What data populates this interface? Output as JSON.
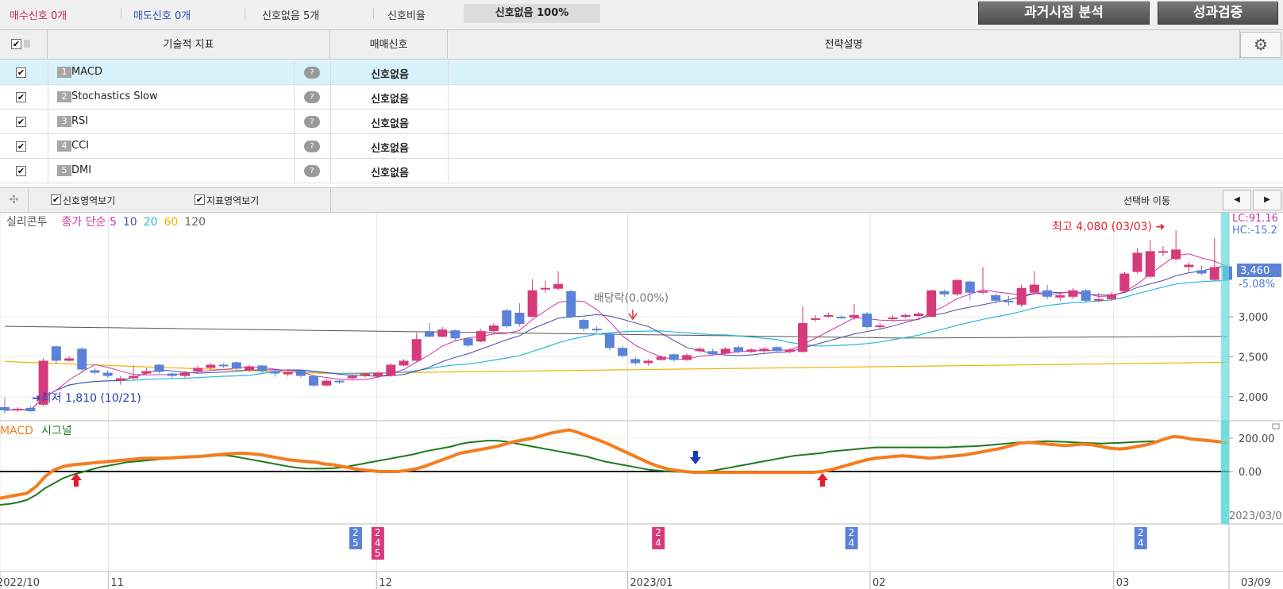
{
  "summary": {
    "buy": "매수신호 0개",
    "sell": "매도신호 0개",
    "none": "신호없음 5개",
    "ratio_label": "신호비율",
    "ratio_value": "신호없음 100%"
  },
  "buttons": {
    "past_analysis": "과거시점 분석",
    "performance": "성과검증"
  },
  "table": {
    "headers": [
      "기술적 지표",
      "매매신호",
      "전략설명"
    ],
    "rows": [
      {
        "num": "1",
        "name": "MACD",
        "signal": "신호없음",
        "checked": true
      },
      {
        "num": "2",
        "name": "Stochastics Slow",
        "signal": "신호없음",
        "checked": true
      },
      {
        "num": "3",
        "name": "RSI",
        "signal": "신호없음",
        "checked": true
      },
      {
        "num": "4",
        "name": "CCI",
        "signal": "신호없음",
        "checked": true
      },
      {
        "num": "5",
        "name": "DMI",
        "signal": "신호없음",
        "checked": true
      }
    ]
  },
  "toolbar": {
    "signal_area": "신호영역보기",
    "indicator_area": "지표영역보기",
    "select_bar_move": "선택바 이동"
  },
  "chart_data": {
    "type": "candlestick",
    "legend": {
      "name": "실리콘투",
      "ma_label": "종가 단순 5",
      "ma_periods": [
        "10",
        "20",
        "60",
        "120"
      ],
      "ma_colors": {
        "5": "#d0369f",
        "10": "#4b4bb0",
        "20": "#2ab6e0",
        "60": "#f0b400",
        "120": "#555555"
      }
    },
    "price_axis": {
      "ticks": [
        "3,000",
        "2,500",
        "2,000"
      ],
      "ylim": [
        1700,
        4300
      ]
    },
    "labels": {
      "high": "최고 4,080 (03/03) ➜",
      "low": "➜최저 1,810 (10/21)",
      "ex_div": "배당락(0.00%)",
      "lc": "LC:91.16",
      "hc": "HC:-15.2",
      "current_price": "3,460",
      "change": "-5.08%"
    },
    "candles": [
      {
        "o": 1870,
        "c": 1830,
        "h": 1990,
        "l": 1790
      },
      {
        "o": 1840,
        "c": 1850,
        "h": 1870,
        "l": 1810
      },
      {
        "o": 1860,
        "c": 1820,
        "h": 1880,
        "l": 1810
      },
      {
        "o": 1900,
        "c": 2450,
        "h": 2480,
        "l": 1880
      },
      {
        "o": 2630,
        "c": 2450,
        "h": 2640,
        "l": 2420
      },
      {
        "o": 2450,
        "c": 2480,
        "h": 2510,
        "l": 2440
      },
      {
        "o": 2600,
        "c": 2340,
        "h": 2620,
        "l": 2300
      },
      {
        "o": 2330,
        "c": 2300,
        "h": 2360,
        "l": 2280
      },
      {
        "o": 2300,
        "c": 2260,
        "h": 2330,
        "l": 2240
      },
      {
        "o": 2200,
        "c": 2230,
        "h": 2260,
        "l": 2150
      },
      {
        "o": 2230,
        "c": 2260,
        "h": 2390,
        "l": 2210
      },
      {
        "o": 2290,
        "c": 2320,
        "h": 2360,
        "l": 2270
      },
      {
        "o": 2400,
        "c": 2310,
        "h": 2410,
        "l": 2290
      },
      {
        "o": 2290,
        "c": 2260,
        "h": 2300,
        "l": 2240
      },
      {
        "o": 2260,
        "c": 2300,
        "h": 2320,
        "l": 2240
      },
      {
        "o": 2320,
        "c": 2360,
        "h": 2390,
        "l": 2300
      },
      {
        "o": 2360,
        "c": 2400,
        "h": 2420,
        "l": 2340
      },
      {
        "o": 2400,
        "c": 2380,
        "h": 2420,
        "l": 2360
      },
      {
        "o": 2430,
        "c": 2350,
        "h": 2440,
        "l": 2330
      },
      {
        "o": 2330,
        "c": 2380,
        "h": 2400,
        "l": 2310
      },
      {
        "o": 2390,
        "c": 2320,
        "h": 2400,
        "l": 2300
      },
      {
        "o": 2320,
        "c": 2290,
        "h": 2340,
        "l": 2250
      },
      {
        "o": 2280,
        "c": 2310,
        "h": 2330,
        "l": 2250
      },
      {
        "o": 2330,
        "c": 2260,
        "h": 2340,
        "l": 2240
      },
      {
        "o": 2260,
        "c": 2140,
        "h": 2270,
        "l": 2120
      },
      {
        "o": 2140,
        "c": 2200,
        "h": 2220,
        "l": 2130
      },
      {
        "o": 2200,
        "c": 2180,
        "h": 2210,
        "l": 2160
      },
      {
        "o": 2230,
        "c": 2260,
        "h": 2280,
        "l": 2220
      },
      {
        "o": 2260,
        "c": 2290,
        "h": 2300,
        "l": 2240
      },
      {
        "o": 2260,
        "c": 2300,
        "h": 2320,
        "l": 2240
      },
      {
        "o": 2260,
        "c": 2400,
        "h": 2420,
        "l": 2250
      },
      {
        "o": 2390,
        "c": 2450,
        "h": 2470,
        "l": 2380
      },
      {
        "o": 2450,
        "c": 2720,
        "h": 2800,
        "l": 2440
      },
      {
        "o": 2820,
        "c": 2750,
        "h": 2920,
        "l": 2740
      },
      {
        "o": 2750,
        "c": 2840,
        "h": 2870,
        "l": 2740
      },
      {
        "o": 2830,
        "c": 2730,
        "h": 2840,
        "l": 2700
      },
      {
        "o": 2730,
        "c": 2640,
        "h": 2740,
        "l": 2620
      },
      {
        "o": 2690,
        "c": 2820,
        "h": 2850,
        "l": 2680
      },
      {
        "o": 2820,
        "c": 2890,
        "h": 2920,
        "l": 2800
      },
      {
        "o": 3080,
        "c": 2880,
        "h": 3100,
        "l": 2860
      },
      {
        "o": 3050,
        "c": 2910,
        "h": 3170,
        "l": 2880
      },
      {
        "o": 3000,
        "c": 3330,
        "h": 3470,
        "l": 2990
      },
      {
        "o": 3340,
        "c": 3360,
        "h": 3450,
        "l": 3300
      },
      {
        "o": 3350,
        "c": 3410,
        "h": 3570,
        "l": 3330
      },
      {
        "o": 3320,
        "c": 3000,
        "h": 3340,
        "l": 2980
      },
      {
        "o": 2960,
        "c": 2850,
        "h": 2980,
        "l": 2820
      },
      {
        "o": 2850,
        "c": 2830,
        "h": 2880,
        "l": 2800
      },
      {
        "o": 2790,
        "c": 2610,
        "h": 2800,
        "l": 2580
      },
      {
        "o": 2610,
        "c": 2510,
        "h": 2630,
        "l": 2490
      },
      {
        "o": 2470,
        "c": 2420,
        "h": 2490,
        "l": 2400
      },
      {
        "o": 2420,
        "c": 2450,
        "h": 2470,
        "l": 2390
      },
      {
        "o": 2460,
        "c": 2500,
        "h": 2520,
        "l": 2450
      },
      {
        "o": 2530,
        "c": 2460,
        "h": 2540,
        "l": 2440
      },
      {
        "o": 2460,
        "c": 2520,
        "h": 2540,
        "l": 2450
      },
      {
        "o": 2570,
        "c": 2600,
        "h": 2620,
        "l": 2550
      },
      {
        "o": 2570,
        "c": 2530,
        "h": 2600,
        "l": 2510
      },
      {
        "o": 2540,
        "c": 2600,
        "h": 2620,
        "l": 2520
      },
      {
        "o": 2620,
        "c": 2560,
        "h": 2640,
        "l": 2540
      },
      {
        "o": 2560,
        "c": 2590,
        "h": 2610,
        "l": 2550
      },
      {
        "o": 2570,
        "c": 2600,
        "h": 2620,
        "l": 2550
      },
      {
        "o": 2620,
        "c": 2570,
        "h": 2630,
        "l": 2550
      },
      {
        "o": 2560,
        "c": 2590,
        "h": 2610,
        "l": 2540
      },
      {
        "o": 2560,
        "c": 2920,
        "h": 3130,
        "l": 2550
      },
      {
        "o": 2960,
        "c": 2980,
        "h": 3020,
        "l": 2940
      },
      {
        "o": 3010,
        "c": 3020,
        "h": 3050,
        "l": 2990
      },
      {
        "o": 3000,
        "c": 2990,
        "h": 3020,
        "l": 2970
      },
      {
        "o": 2990,
        "c": 3020,
        "h": 3160,
        "l": 2960
      },
      {
        "o": 3040,
        "c": 2870,
        "h": 3060,
        "l": 2850
      },
      {
        "o": 2870,
        "c": 2890,
        "h": 2920,
        "l": 2840
      },
      {
        "o": 2970,
        "c": 2990,
        "h": 3020,
        "l": 2940
      },
      {
        "o": 3000,
        "c": 3020,
        "h": 3040,
        "l": 2980
      },
      {
        "o": 3010,
        "c": 3040,
        "h": 3060,
        "l": 2990
      },
      {
        "o": 3000,
        "c": 3330,
        "h": 3340,
        "l": 2990
      },
      {
        "o": 3320,
        "c": 3280,
        "h": 3340,
        "l": 3250
      },
      {
        "o": 3280,
        "c": 3460,
        "h": 3470,
        "l": 3260
      },
      {
        "o": 3440,
        "c": 3300,
        "h": 3450,
        "l": 3210
      },
      {
        "o": 3300,
        "c": 3320,
        "h": 3620,
        "l": 3280
      },
      {
        "o": 3270,
        "c": 3200,
        "h": 3290,
        "l": 3170
      },
      {
        "o": 3200,
        "c": 3180,
        "h": 3260,
        "l": 3140
      },
      {
        "o": 3150,
        "c": 3360,
        "h": 3400,
        "l": 3120
      },
      {
        "o": 3300,
        "c": 3400,
        "h": 3570,
        "l": 3280
      },
      {
        "o": 3330,
        "c": 3250,
        "h": 3400,
        "l": 3220
      },
      {
        "o": 3240,
        "c": 3270,
        "h": 3300,
        "l": 3200
      },
      {
        "o": 3250,
        "c": 3330,
        "h": 3360,
        "l": 3220
      },
      {
        "o": 3330,
        "c": 3200,
        "h": 3350,
        "l": 3180
      },
      {
        "o": 3200,
        "c": 3220,
        "h": 3300,
        "l": 3180
      },
      {
        "o": 3220,
        "c": 3280,
        "h": 3310,
        "l": 3200
      },
      {
        "o": 3320,
        "c": 3540,
        "h": 3560,
        "l": 3300
      },
      {
        "o": 3560,
        "c": 3800,
        "h": 3860,
        "l": 3540
      },
      {
        "o": 3500,
        "c": 3820,
        "h": 3960,
        "l": 3480
      },
      {
        "o": 3800,
        "c": 3820,
        "h": 3880,
        "l": 3760
      },
      {
        "o": 3720,
        "c": 3840,
        "h": 4080,
        "l": 3700
      },
      {
        "o": 3620,
        "c": 3650,
        "h": 3680,
        "l": 3560
      },
      {
        "o": 3580,
        "c": 3540,
        "h": 3640,
        "l": 3520
      },
      {
        "o": 3460,
        "c": 3620,
        "h": 3980,
        "l": 3450
      },
      {
        "o": 3630,
        "c": 3460,
        "h": 3660,
        "l": 3450
      }
    ],
    "macd": {
      "legend": [
        "MACD",
        "시그널"
      ],
      "ticks": [
        "200.00",
        "0.00"
      ],
      "macd_values": [
        -160,
        -150,
        -140,
        -130,
        -90,
        -30,
        10,
        30,
        40,
        45,
        50,
        55,
        60,
        65,
        70,
        75,
        80,
        80,
        80,
        82,
        85,
        88,
        90,
        95,
        100,
        105,
        108,
        110,
        105,
        100,
        90,
        80,
        70,
        65,
        60,
        55,
        45,
        40,
        30,
        20,
        10,
        5,
        0,
        0,
        0,
        5,
        15,
        30,
        50,
        70,
        90,
        110,
        120,
        130,
        140,
        150,
        165,
        180,
        190,
        200,
        215,
        230,
        240,
        250,
        235,
        215,
        195,
        175,
        150,
        125,
        100,
        75,
        50,
        30,
        15,
        5,
        0,
        -5,
        -5,
        -5,
        -5,
        -5,
        -5,
        -5,
        -5,
        -5,
        -5,
        -5,
        -5,
        -5,
        -5,
        0,
        10,
        25,
        40,
        55,
        70,
        80,
        85,
        90,
        95,
        90,
        85,
        80,
        85,
        90,
        95,
        100,
        110,
        120,
        130,
        140,
        155,
        170,
        175,
        170,
        165,
        160,
        155,
        160,
        165,
        160,
        150,
        140,
        135,
        140,
        150,
        160,
        175,
        195,
        210,
        205,
        195,
        190,
        185,
        180,
        170
      ],
      "signal_values": [
        -200,
        -195,
        -185,
        -170,
        -140,
        -100,
        -70,
        -40,
        -20,
        -5,
        10,
        25,
        35,
        45,
        55,
        60,
        65,
        70,
        75,
        78,
        82,
        85,
        90,
        93,
        95,
        97,
        90,
        80,
        70,
        60,
        50,
        40,
        30,
        22,
        18,
        17,
        18,
        20,
        25,
        35,
        45,
        55,
        65,
        75,
        85,
        95,
        105,
        120,
        130,
        140,
        150,
        165,
        175,
        180,
        185,
        185,
        180,
        170,
        160,
        150,
        140,
        130,
        120,
        110,
        100,
        90,
        75,
        60,
        50,
        40,
        30,
        20,
        10,
        5,
        0,
        -2,
        -3,
        -2,
        0,
        5,
        15,
        25,
        35,
        45,
        55,
        65,
        75,
        85,
        95,
        100,
        105,
        110,
        120,
        125,
        130,
        135,
        140,
        145,
        145,
        145,
        145,
        145,
        145,
        145,
        145,
        145,
        148,
        150,
        152,
        155,
        160,
        165,
        170,
        175,
        178,
        180,
        182,
        180,
        178,
        175,
        172,
        170,
        168,
        170,
        172,
        175,
        178,
        180,
        182
      ]
    },
    "signal_markers": [
      {
        "position": 0.289,
        "digits": [
          "2",
          "5"
        ],
        "kind": "sell"
      },
      {
        "position": 0.307,
        "digits": [
          "2",
          "4",
          "5"
        ],
        "kind": "buy"
      },
      {
        "position": 0.535,
        "digits": [
          "2",
          "4"
        ],
        "kind": "buy"
      },
      {
        "position": 0.692,
        "digits": [
          "2",
          "4"
        ],
        "kind": "sell"
      },
      {
        "position": 0.927,
        "digits": [
          "2",
          "4"
        ],
        "kind": "sell"
      }
    ],
    "dates": [
      {
        "label": "2022/10",
        "position": 0.0
      },
      {
        "label": "11",
        "position": 0.088
      },
      {
        "label": "12",
        "position": 0.306
      },
      {
        "label": "2023/01",
        "position": 0.51
      },
      {
        "label": "02",
        "position": 0.707
      },
      {
        "label": "03",
        "position": 0.905
      },
      {
        "label": "03/09",
        "position": 0.98
      }
    ],
    "current_date": "2023/03/0",
    "colors": {
      "up": "#d63a7c",
      "down": "#5b82d8",
      "macd": "#f57c1f",
      "signal": "#1e7a1e",
      "cursor": "#60dcdc"
    }
  }
}
